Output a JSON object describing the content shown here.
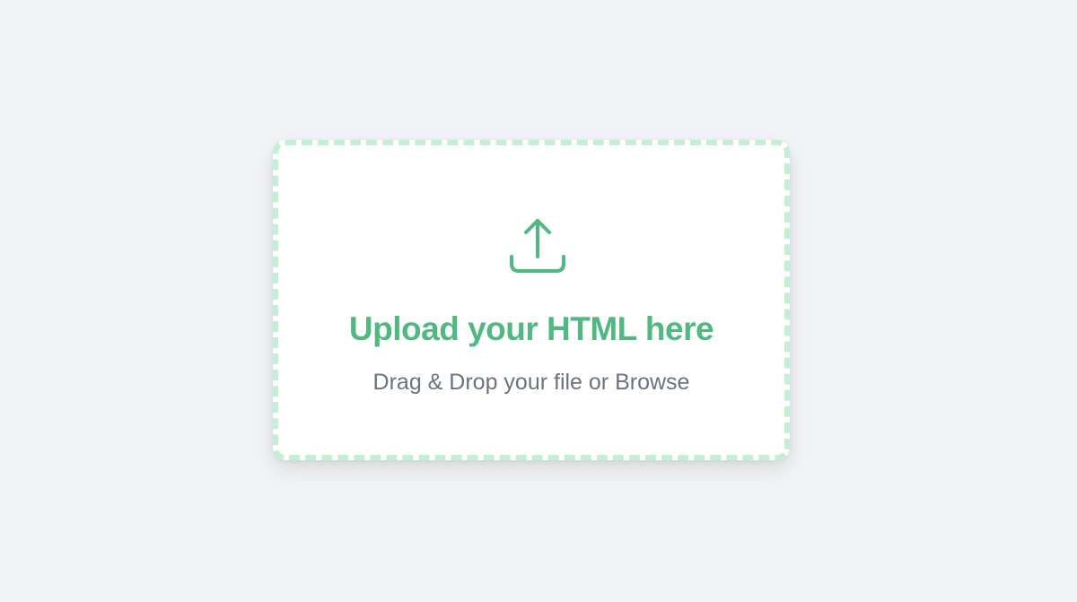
{
  "dropzone": {
    "icon": "upload-icon",
    "title": "Upload your HTML here",
    "subtitle_prefix": "Drag & Drop your file or ",
    "browse_label": "Browse"
  },
  "colors": {
    "background": "#f2f3f5",
    "card": "#ffffff",
    "accent": "#52b882",
    "dashed_border": "#c2f0d2",
    "subtitle_text": "#6b7280"
  }
}
